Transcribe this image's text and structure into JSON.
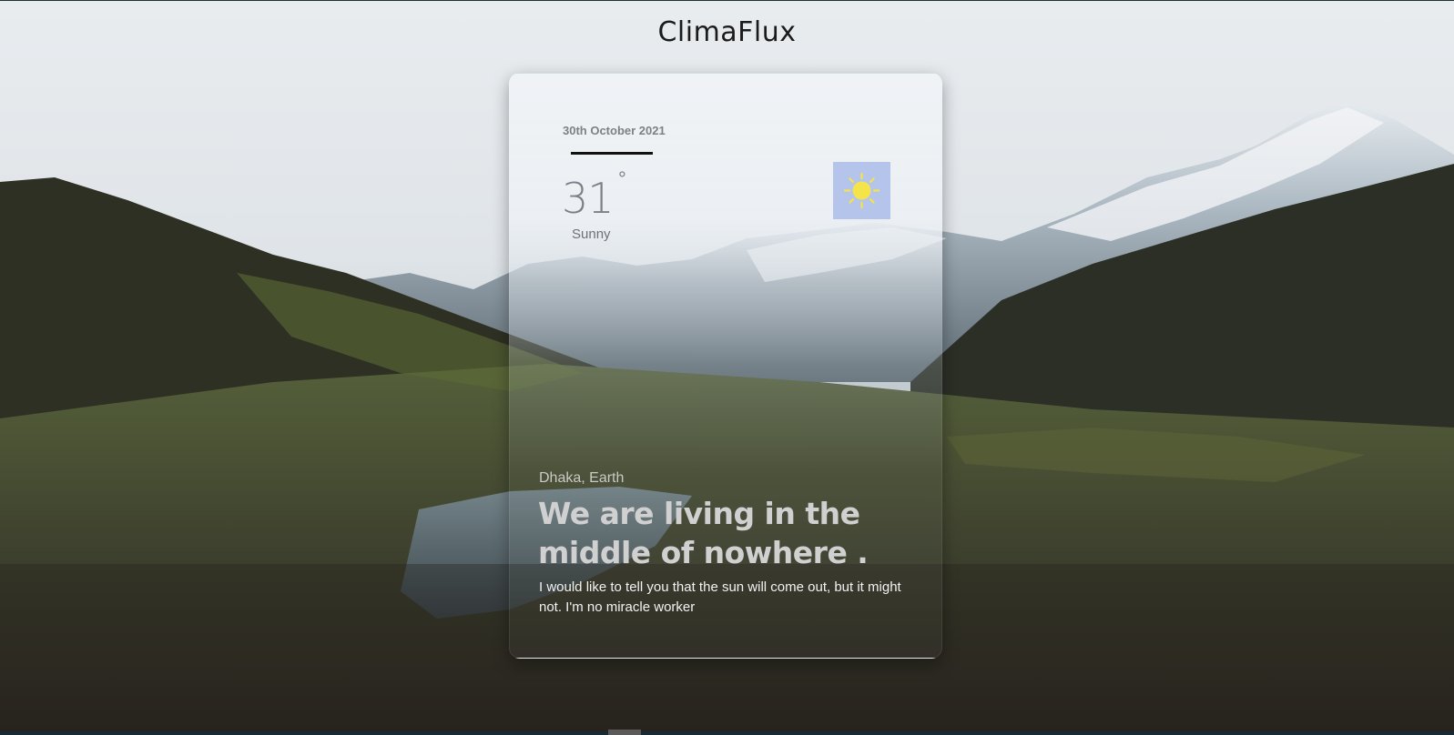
{
  "app": {
    "title": "ClimaFlux"
  },
  "weather": {
    "date": "30th October 2021",
    "temperature": "31",
    "degree_symbol": "°",
    "condition": "Sunny",
    "icon": "sun-icon"
  },
  "info": {
    "location": "Dhaka, Earth",
    "headline": "We are living in the middle of nowhere .",
    "subtext": "I would like to tell you that the sun will come out, but it might not. I'm no miracle worker"
  },
  "colors": {
    "card_bg": "#eef1f4",
    "icon_bg": "#b4c4ea",
    "sun": "#f5e34a"
  }
}
